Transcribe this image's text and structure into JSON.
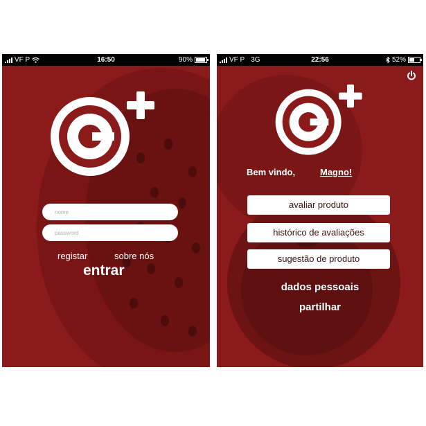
{
  "screens": {
    "login": {
      "status_bar": {
        "carrier": "VF P",
        "time": "16:50",
        "battery": "90%",
        "battery_level": 0.9
      },
      "form": {
        "name_placeholder": "nome",
        "password_placeholder": "password"
      },
      "links": {
        "register": "registar",
        "about": "sobre nós"
      },
      "submit_label": "entrar"
    },
    "menu": {
      "status_bar": {
        "carrier": "VF P",
        "network": "3G",
        "time": "22:56",
        "battery": "52%",
        "battery_level": 0.52
      },
      "welcome": {
        "greeting": "Bem vindo,",
        "user_name": "Magno!"
      },
      "buttons": [
        "avaliar produto",
        "histórico de avaliações",
        "sugestão de produto"
      ],
      "links": [
        "dados pessoais",
        "partilhar"
      ]
    }
  },
  "icons": [
    "logo-c-plus-icon",
    "signal-bars-icon",
    "wifi-icon",
    "bluetooth-icon",
    "battery-icon",
    "power-icon"
  ],
  "colors": {
    "background": "#8b1a1a",
    "button": "#ffffff",
    "text": "#ffffff"
  }
}
